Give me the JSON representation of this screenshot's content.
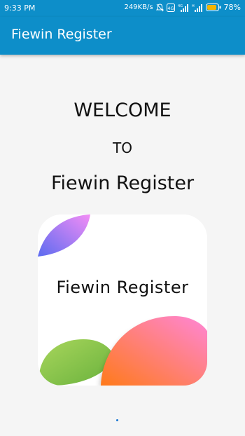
{
  "status_bar": {
    "time": "9:33 PM",
    "net_speed": "249KB/s",
    "battery": "78%",
    "icons": [
      "mute-icon",
      "sim-badge-icon",
      "signal-icon",
      "signal-icon",
      "battery-icon"
    ],
    "icon_labels": {
      "sim_badge": "4G",
      "sim1_signal": "4G",
      "sim2_signal": "H"
    }
  },
  "app_bar": {
    "title": "Fiewin Register"
  },
  "welcome": {
    "line1": "WELCOME",
    "line2": "TO",
    "line3": "Fiewin Register"
  },
  "logo": {
    "text": "Fiewin Register"
  },
  "colors": {
    "primary": "#0d8ec9",
    "background": "#f5f5f5",
    "page_indicator": "#1976d2"
  }
}
